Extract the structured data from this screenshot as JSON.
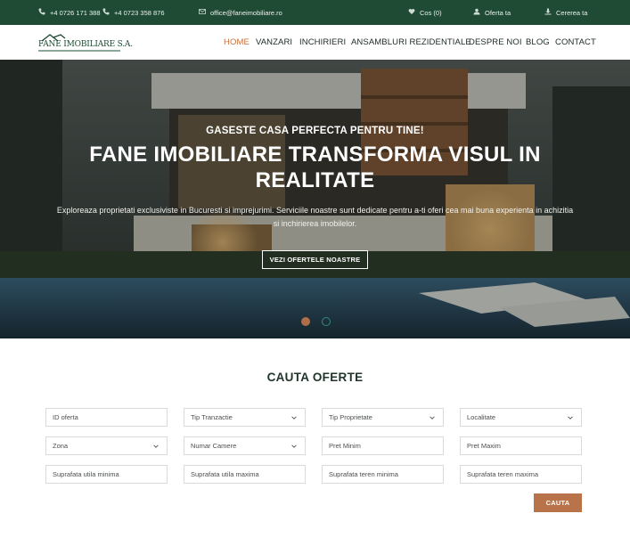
{
  "topbar": {
    "phone1": "+4 0726 171 388",
    "phone2": "+4 0723 358 876",
    "email": "office@faneimobiliare.ro",
    "cart": "Cos (0)",
    "offer": "Oferta ta",
    "request": "Cererea ta"
  },
  "logo": {
    "name": "FANE IMOBILIARE S.A."
  },
  "nav": {
    "items": [
      "HOME",
      "VANZARI",
      "INCHIRIERI",
      "ANSAMBLURI REZIDENTIALE",
      "DESPRE NOI",
      "BLOG",
      "CONTACT"
    ],
    "active_index": 0
  },
  "hero": {
    "eyebrow": "GASESTE CASA PERFECTA PENTRU TINE!",
    "headline": "FANE IMOBILIARE TRANSFORMA VISUL IN REALITATE",
    "description": "Exploreaza proprietati exclusiviste in Bucuresti si imprejurimi. Serviciile noastre sunt dedicate pentru a-ti oferi cea mai buna experienta in achizitia si inchirierea imobilelor.",
    "cta": "VEZI OFERTELE NOASTRE",
    "slide_active": 1,
    "slide_count": 2
  },
  "search": {
    "title": "CAUTA OFERTE",
    "fields": [
      {
        "label": "ID oferta",
        "dropdown": false
      },
      {
        "label": "Tip Tranzactie",
        "dropdown": true
      },
      {
        "label": "Tip Proprietate",
        "dropdown": true
      },
      {
        "label": "Localitate",
        "dropdown": true
      },
      {
        "label": "Zona",
        "dropdown": true
      },
      {
        "label": "Numar Camere",
        "dropdown": true
      },
      {
        "label": "Pret Minim",
        "dropdown": false
      },
      {
        "label": "Pret Maxim",
        "dropdown": false
      },
      {
        "label": "Suprafata utila minima",
        "dropdown": false
      },
      {
        "label": "Suprafata utila maxima",
        "dropdown": false
      },
      {
        "label": "Suprafata teren minima",
        "dropdown": false
      },
      {
        "label": "Suprafata teren maxima",
        "dropdown": false
      }
    ],
    "submit": "CAUTA"
  },
  "colors": {
    "brand_green": "#1f4a34",
    "accent": "#c86f3a",
    "button": "#b9734a",
    "slide_active": "#c9794a",
    "slide_inactive": "#2f8d7a"
  }
}
